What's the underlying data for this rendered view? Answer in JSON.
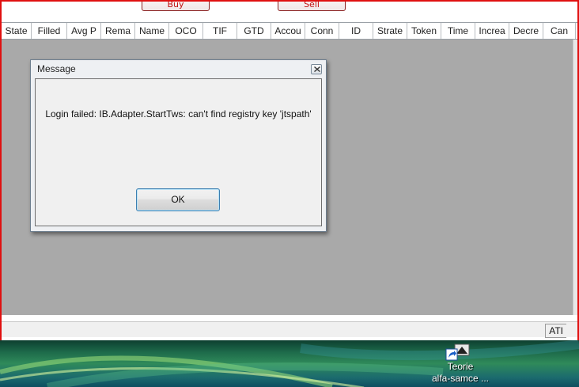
{
  "toolbar": {
    "buy_label": "Buy",
    "sell_label": "Sell"
  },
  "grid": {
    "columns": [
      "State",
      "Filled",
      "Avg P",
      "Rema",
      "Name",
      "OCO",
      "TIF",
      "GTD",
      "Accou",
      "Conn",
      "ID",
      "Strate",
      "Token",
      "Time",
      "Increa",
      "Decre",
      "Can"
    ]
  },
  "status_bar": {
    "indicator": "ATI"
  },
  "dialog": {
    "title": "Message",
    "message": "Login failed: IB.Adapter.StartTws: can't find registry key 'jtspath'",
    "ok_label": "OK",
    "close_icon": "close-icon"
  },
  "desktop": {
    "shortcut_line1": "Teorie",
    "shortcut_line2": "alfa-samce ...",
    "shortcut_icon": "shortcut-icon"
  },
  "colors": {
    "window_border": "#e01010",
    "grid_background": "#a9a9a9",
    "ok_border": "#3c7fb1"
  }
}
